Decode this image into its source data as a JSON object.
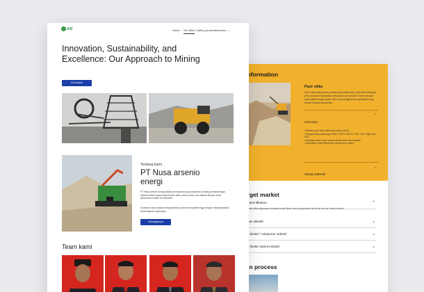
{
  "back_page": {
    "product_heading": "t information",
    "product_label": "Pasir silika",
    "product_desc": "Pasir silika yang kami produksi dan pelihat kan. Memiliki beberapa jenis ukuran berdasarkan kebutuhan dari industri. Kami menjual pasir silika dengan kadar SiO2 yang tinggi serta spesifikasi yang sesuai dengan kebutuhan.",
    "info_label": "Informasi",
    "info_items": [
      "• Butiran pasir silika berbentuk kristal (SiO2).",
      "• Mengandung kandungan SiO2, Fe2O3, Al2O3, TiO2, CaO, MgO dan K2O.",
      "• Sebagai bahan baku utama industri kaca dan keramik.",
      "• Digunakan untuk filtrasi dan pengecoran logam."
    ],
    "sizing_label": "Sizing material",
    "target_heading": "target market",
    "market_items": [
      {
        "label": "ment filtration",
        "chevron": "^"
      },
      {
        "label": "han abrasit",
        "chevron": "v"
      },
      {
        "label": "u ikutan / campuran industri",
        "chevron": "v"
      },
      {
        "label": "u ikutan utama industri",
        "chevron": "v"
      }
    ],
    "market_desc": "Pasir silika digunakan sebagai media filtrasi untuk pengolahan air bersih dan air limbah industri.",
    "process_heading": "tion process"
  },
  "front_page": {
    "logo_text": "ASI",
    "nav": [
      {
        "label": "Home",
        "active": false
      },
      {
        "label": "Our Mine",
        "active": true
      },
      {
        "label": "Gallery products",
        "active": false
      },
      {
        "label": "Services ⌄",
        "active": false
      }
    ],
    "hero_title": "Innovation, Sustainability, and Excellence: Our Approach to Mining",
    "hero_button": "Get started",
    "about_label": "Tentang kami",
    "about_title": "PT Nusa arsenio energi",
    "about_desc": "PT Nusa arsenio energi adalah perusahaan yang bergerak di bidang pertambangan mineral bukan logam seperti pasir silika, pasir kuarsa, dan batuan lainnya untuk kebutuhan industri di Indonesia.",
    "about_note": "Komitmen kami adalah menghadirkan produk berkualitas tinggi dengan mengutamakan keberlanjutan lingkungan.",
    "about_button": "Selengkapnya",
    "team_title": "Team kami"
  },
  "colors": {
    "accent_yellow": "#f2b12c",
    "button_blue": "#1b3ea8",
    "team_red": "#d4261f"
  }
}
